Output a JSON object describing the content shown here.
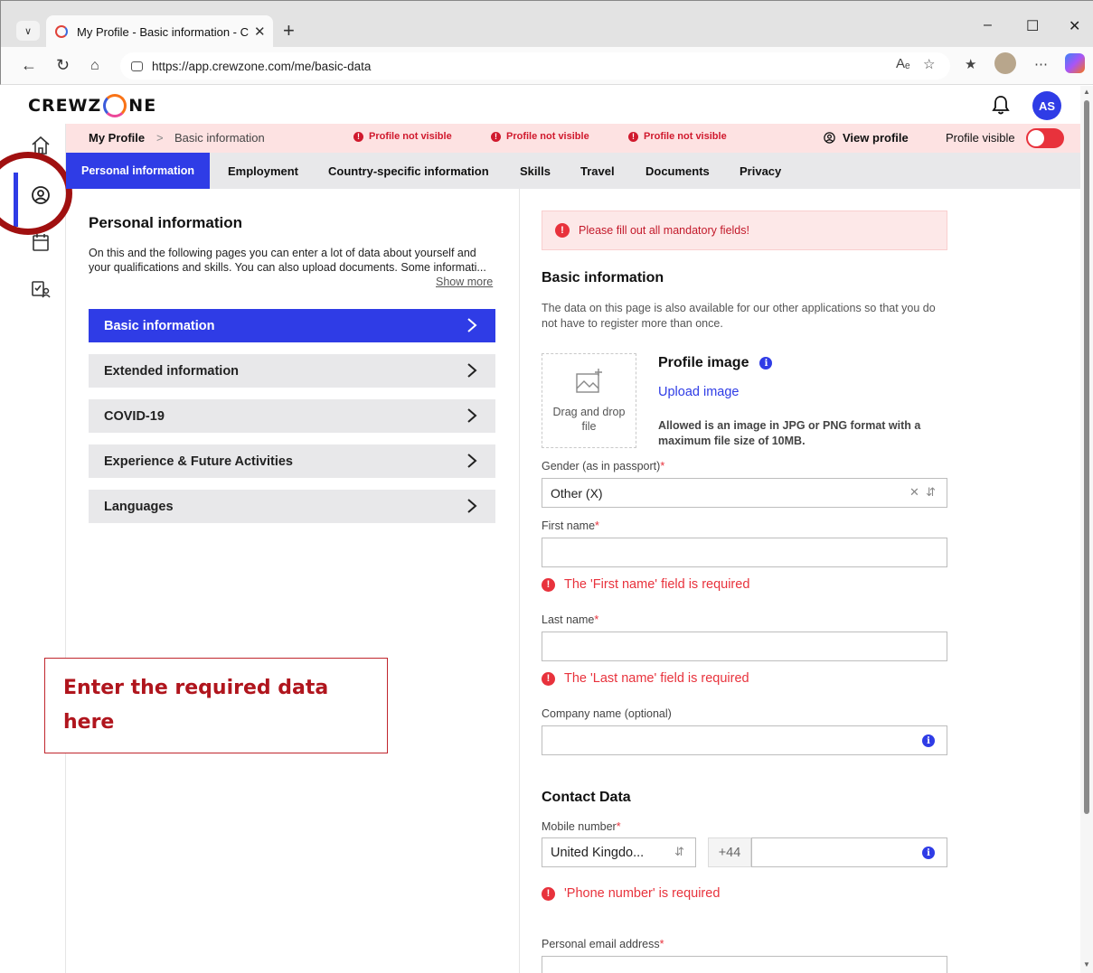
{
  "browser": {
    "tab_title": "My Profile - Basic information - Cr",
    "url": "https://app.crewzone.com/me/basic-data"
  },
  "app": {
    "logo_left": "CREWZ",
    "logo_right": "NE",
    "avatar_initials": "AS"
  },
  "breadcrumb": {
    "root": "My Profile",
    "separator": ">",
    "current": "Basic information"
  },
  "status": {
    "warnings": [
      "Profile not visible",
      "Profile not visible",
      "Profile not visible"
    ],
    "view_profile": "View profile",
    "visible_label": "Profile visible"
  },
  "tabs": [
    {
      "label": "Personal information",
      "active": true
    },
    {
      "label": "Employment"
    },
    {
      "label": "Country-specific information"
    },
    {
      "label": "Skills"
    },
    {
      "label": "Travel"
    },
    {
      "label": "Documents"
    },
    {
      "label": "Privacy"
    }
  ],
  "left": {
    "title": "Personal information",
    "description": "On this and the following pages you can enter a lot of data about yourself and your qualifications and skills. You can also upload documents. Some informati...",
    "show_more": "Show more",
    "menu": [
      {
        "label": "Basic information",
        "active": true
      },
      {
        "label": "Extended information"
      },
      {
        "label": "COVID-19"
      },
      {
        "label": "Experience & Future Activities"
      },
      {
        "label": "Languages"
      }
    ]
  },
  "callout": {
    "line1": "Enter the required data",
    "line2": "here"
  },
  "form": {
    "alert": "Please fill out all mandatory fields!",
    "basic_title": "Basic information",
    "basic_desc": "The data on this page is also available for our other applications so that you do not have to register more than once.",
    "dropzone_text": "Drag and drop file",
    "profile_image_title": "Profile image",
    "upload_link": "Upload image",
    "image_note": "Allowed is an image in JPG or PNG format with a maximum file size of 10MB.",
    "gender_label": "Gender (as in passport)",
    "gender_value": "Other (X)",
    "first_name_label": "First name",
    "first_name_value": "",
    "first_name_error": "The 'First name' field is required",
    "last_name_label": "Last name",
    "last_name_value": "",
    "last_name_error": "The 'Last name' field is required",
    "company_label": "Company name (optional)",
    "company_value": "",
    "contact_title": "Contact Data",
    "mobile_label": "Mobile number",
    "country_value": "United Kingdo...",
    "prefix": "+44",
    "phone_value": "",
    "phone_error": "'Phone number' is required",
    "email_label": "Personal email address",
    "required_mark": "*"
  },
  "colors": {
    "brand_blue": "#2f3ce6",
    "error_red": "#e8323c",
    "warning_bg": "#fde2e2",
    "callout_red": "#b0151d"
  }
}
